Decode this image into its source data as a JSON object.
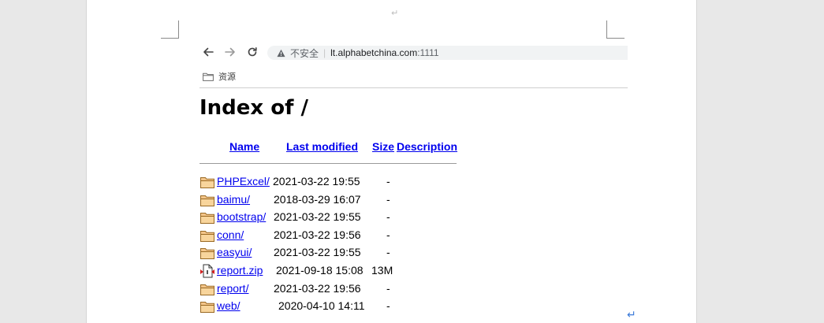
{
  "document": {
    "paragraph_mark": "↵"
  },
  "browser": {
    "security_label": "不安全",
    "separator": "|",
    "url_host": "lt.alphabetchina.com",
    "url_port": ":1111",
    "bookmarks": [
      {
        "label": "资源",
        "icon": "folder-icon"
      }
    ]
  },
  "listing": {
    "title": "Index of /",
    "columns": {
      "name": "Name",
      "last_modified": "Last modified",
      "size": "Size",
      "description": "Description"
    },
    "rows": [
      {
        "name": "PHPExcel/",
        "last_modified": "2021-03-22 19:55",
        "size": "-",
        "icon": "folder-icon"
      },
      {
        "name": "baimu/",
        "last_modified": "2018-03-29 16:07",
        "size": "-",
        "icon": "folder-icon"
      },
      {
        "name": "bootstrap/",
        "last_modified": "2021-03-22 19:55",
        "size": "-",
        "icon": "folder-icon"
      },
      {
        "name": "conn/",
        "last_modified": "2021-03-22 19:56",
        "size": "-",
        "icon": "folder-icon"
      },
      {
        "name": "easyui/",
        "last_modified": "2021-03-22 19:55",
        "size": "-",
        "icon": "folder-icon"
      },
      {
        "name": "report.zip",
        "last_modified": "2021-09-18 15:08",
        "size": "13M",
        "icon": "compressed-file-icon"
      },
      {
        "name": "report/",
        "last_modified": "2021-03-22 19:56",
        "size": "-",
        "icon": "folder-icon"
      },
      {
        "name": "web/",
        "last_modified": "2020-04-10 14:11",
        "size": "-",
        "icon": "folder-icon"
      }
    ]
  },
  "colors": {
    "link": "#0000ee",
    "folder_fill": "#f3c58a",
    "folder_stroke": "#b07a2c"
  }
}
